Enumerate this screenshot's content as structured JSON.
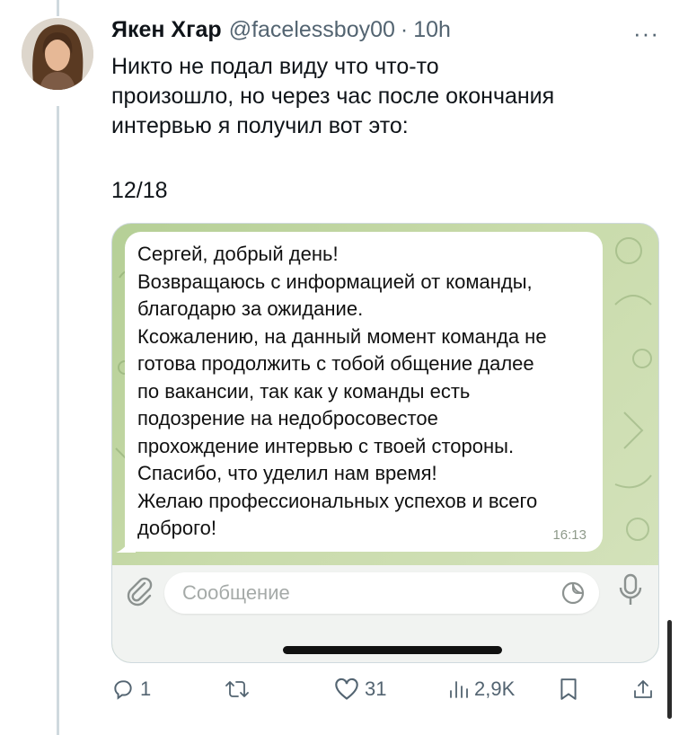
{
  "tweet": {
    "author_name": "Якен Хгар",
    "handle": "@facelessboy00",
    "separator": "·",
    "time": "10h",
    "more": "···",
    "text_lines": [
      "Никто не подал виду что что-то",
      "произошло, но через час после окончания",
      "интервью я получил вот это:"
    ],
    "counter": "12/18"
  },
  "screenshot": {
    "message_lines": [
      "Сергей, добрый день!",
      "Возвращаюсь с информацией от команды,",
      "благодарю за ожидание.",
      "Ксожалению, на данный момент команда не",
      "готова продолжить с тобой общение далее",
      "по вакансии, так как у команды есть",
      "подозрение на недобросовестое",
      "прохождение интервью с твоей стороны.",
      "Спасибо, что уделил нам время!",
      "Желаю профессиональных успехов и всего",
      "доброго!"
    ],
    "message_time": "16:13",
    "input_placeholder": "Сообщение",
    "background_color": "#c4d8a6"
  },
  "actions": {
    "replies": "1",
    "reposts": "",
    "likes": "31",
    "views": "2,9K"
  },
  "icons": [
    "reply-icon",
    "repost-icon",
    "like-icon",
    "views-icon",
    "bookmark-icon",
    "share-icon",
    "attach-icon",
    "sticker-icon",
    "mic-icon"
  ]
}
